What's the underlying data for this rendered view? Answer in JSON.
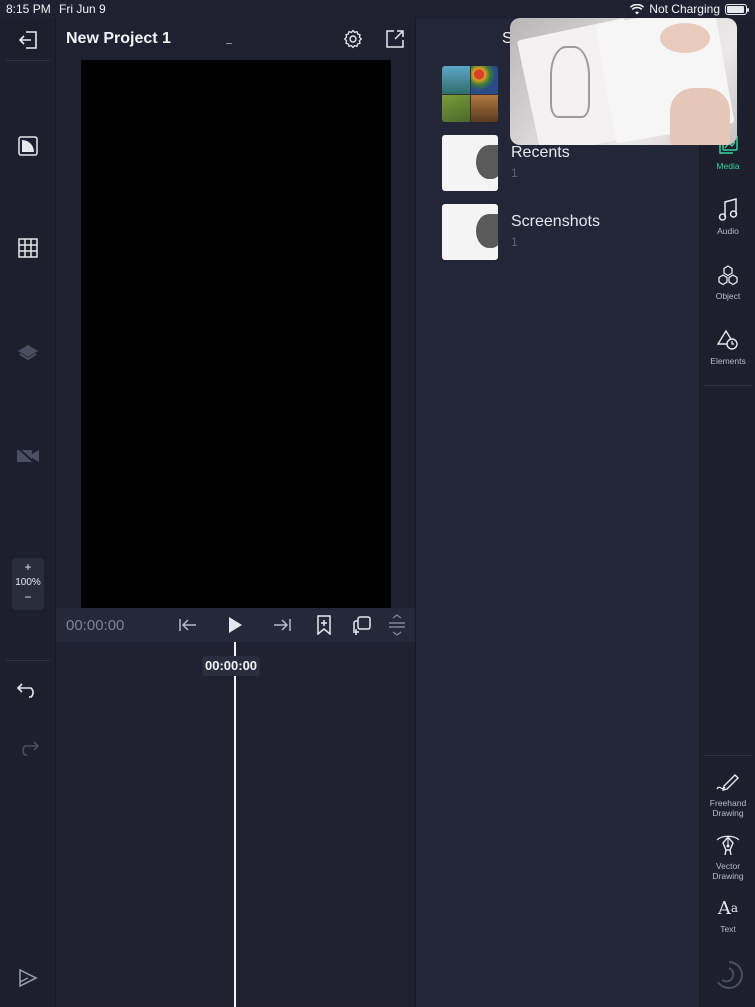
{
  "status_bar": {
    "time": "8:15 PM",
    "date": "Fri Jun 9",
    "charging": "Not Charging"
  },
  "header": {
    "project_title": "New Project 1"
  },
  "left_tools": {
    "zoom_in": "+",
    "zoom_level": "100%",
    "zoom_out": "−"
  },
  "transport": {
    "timecode": "00:00:00"
  },
  "timeline": {
    "playhead_time": "00:00:00"
  },
  "media_panel": {
    "title": "S",
    "albums": [
      {
        "name": "",
        "count": ""
      },
      {
        "name": "Recents",
        "count": "1"
      },
      {
        "name": "Screenshots",
        "count": "1"
      }
    ]
  },
  "right_rail": {
    "tabs": [
      {
        "label": "Media",
        "icon": "media-icon",
        "active": true
      },
      {
        "label": "Audio",
        "icon": "music-note-icon",
        "active": false
      },
      {
        "label": "Object",
        "icon": "object-icon",
        "active": false
      },
      {
        "label": "Elements",
        "icon": "shapes-icon",
        "active": false
      }
    ],
    "tools": [
      {
        "label_line1": "Freehand",
        "label_line2": "Drawing"
      },
      {
        "label_line1": "Vector",
        "label_line2": "Drawing"
      },
      {
        "label_line1": "Text",
        "label_line2": ""
      }
    ]
  },
  "colors": {
    "accent": "#36d399",
    "background": "#1f2130",
    "panel": "#232636"
  }
}
